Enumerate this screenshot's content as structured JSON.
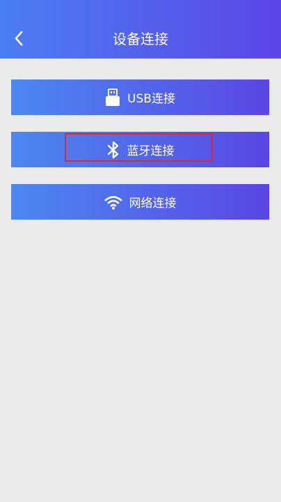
{
  "header": {
    "title": "设备连接",
    "back_icon": "chevron-left-icon"
  },
  "buttons": [
    {
      "id": "usb",
      "label": "USB连接",
      "icon": "usb-icon"
    },
    {
      "id": "bluetooth",
      "label": "蓝牙连接",
      "icon": "bluetooth-icon"
    },
    {
      "id": "network",
      "label": "网络连接",
      "icon": "wifi-icon"
    }
  ],
  "colors": {
    "header_gradient_start": "#4b7ef2",
    "header_gradient_end": "#5c45e6",
    "button_gradient_start": "#4c88f0",
    "button_gradient_end": "#5a46e4",
    "background": "#ebebeb",
    "highlight": "#d8283a"
  }
}
